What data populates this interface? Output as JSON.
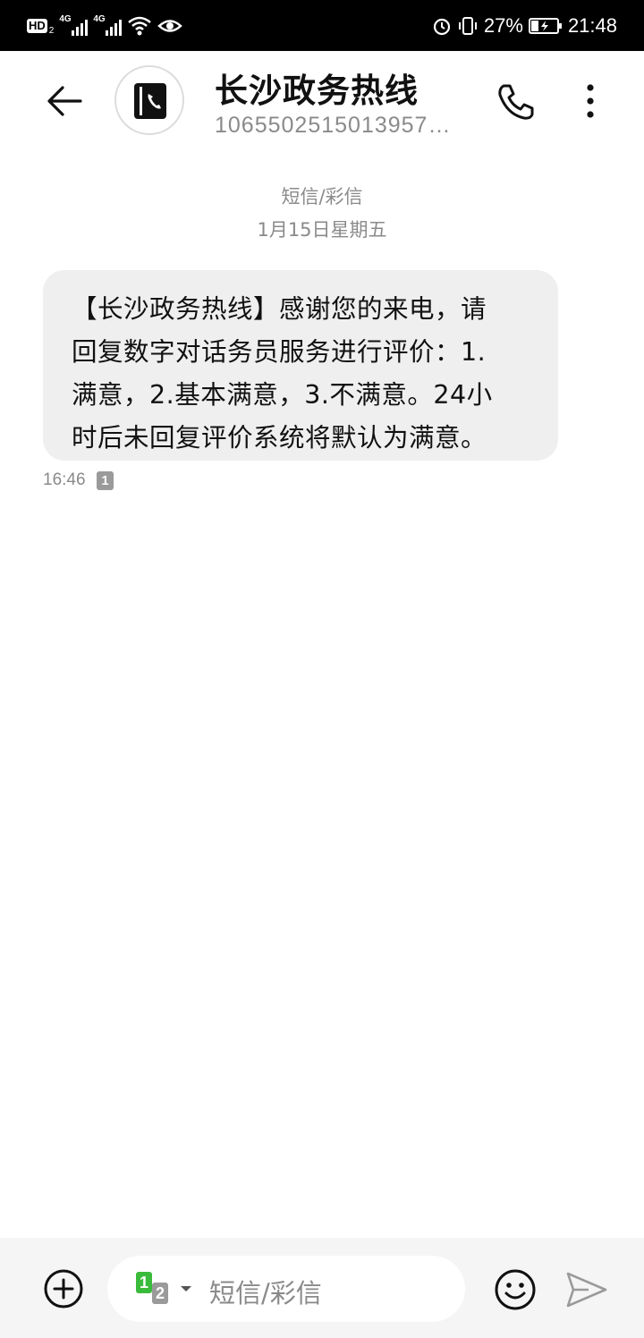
{
  "status_bar": {
    "signal_label": "4G",
    "battery_percent": "27%",
    "time": "21:48",
    "icons": [
      "hd-icon",
      "signal-icon",
      "signal-icon",
      "wifi-icon",
      "eye-icon",
      "alarm-icon",
      "vibrate-icon",
      "battery-icon"
    ]
  },
  "header": {
    "contact_name": "长沙政务热线",
    "contact_number": "1065502515013957…",
    "icons": [
      "back-arrow-icon",
      "contact-phone-icon",
      "call-icon",
      "more-vertical-icon"
    ]
  },
  "conversation": {
    "channel_label": "短信/彩信",
    "date": "1月15日星期五",
    "messages": [
      {
        "lines": [
          "【长沙政务热线】感谢您的来电，请",
          "回复数字对话务员服务进行评价：1.",
          "满意，2.基本满意，3.不满意。24小",
          "时后未回复评价系统将默认为满意。"
        ],
        "time": "16:46",
        "sim": "1"
      }
    ]
  },
  "composer": {
    "sim_primary": "1",
    "sim_secondary": "2",
    "placeholder": "短信/彩信",
    "icons": [
      "plus-circle-icon",
      "sim-select-icon",
      "emoji-icon",
      "send-icon"
    ]
  },
  "colors": {
    "status_bar_bg": "#000000",
    "bubble_bg": "#efefef",
    "sim1_green": "#3bbb3b",
    "muted_text": "#8a8a8a",
    "composer_bg": "#f5f5f5"
  }
}
